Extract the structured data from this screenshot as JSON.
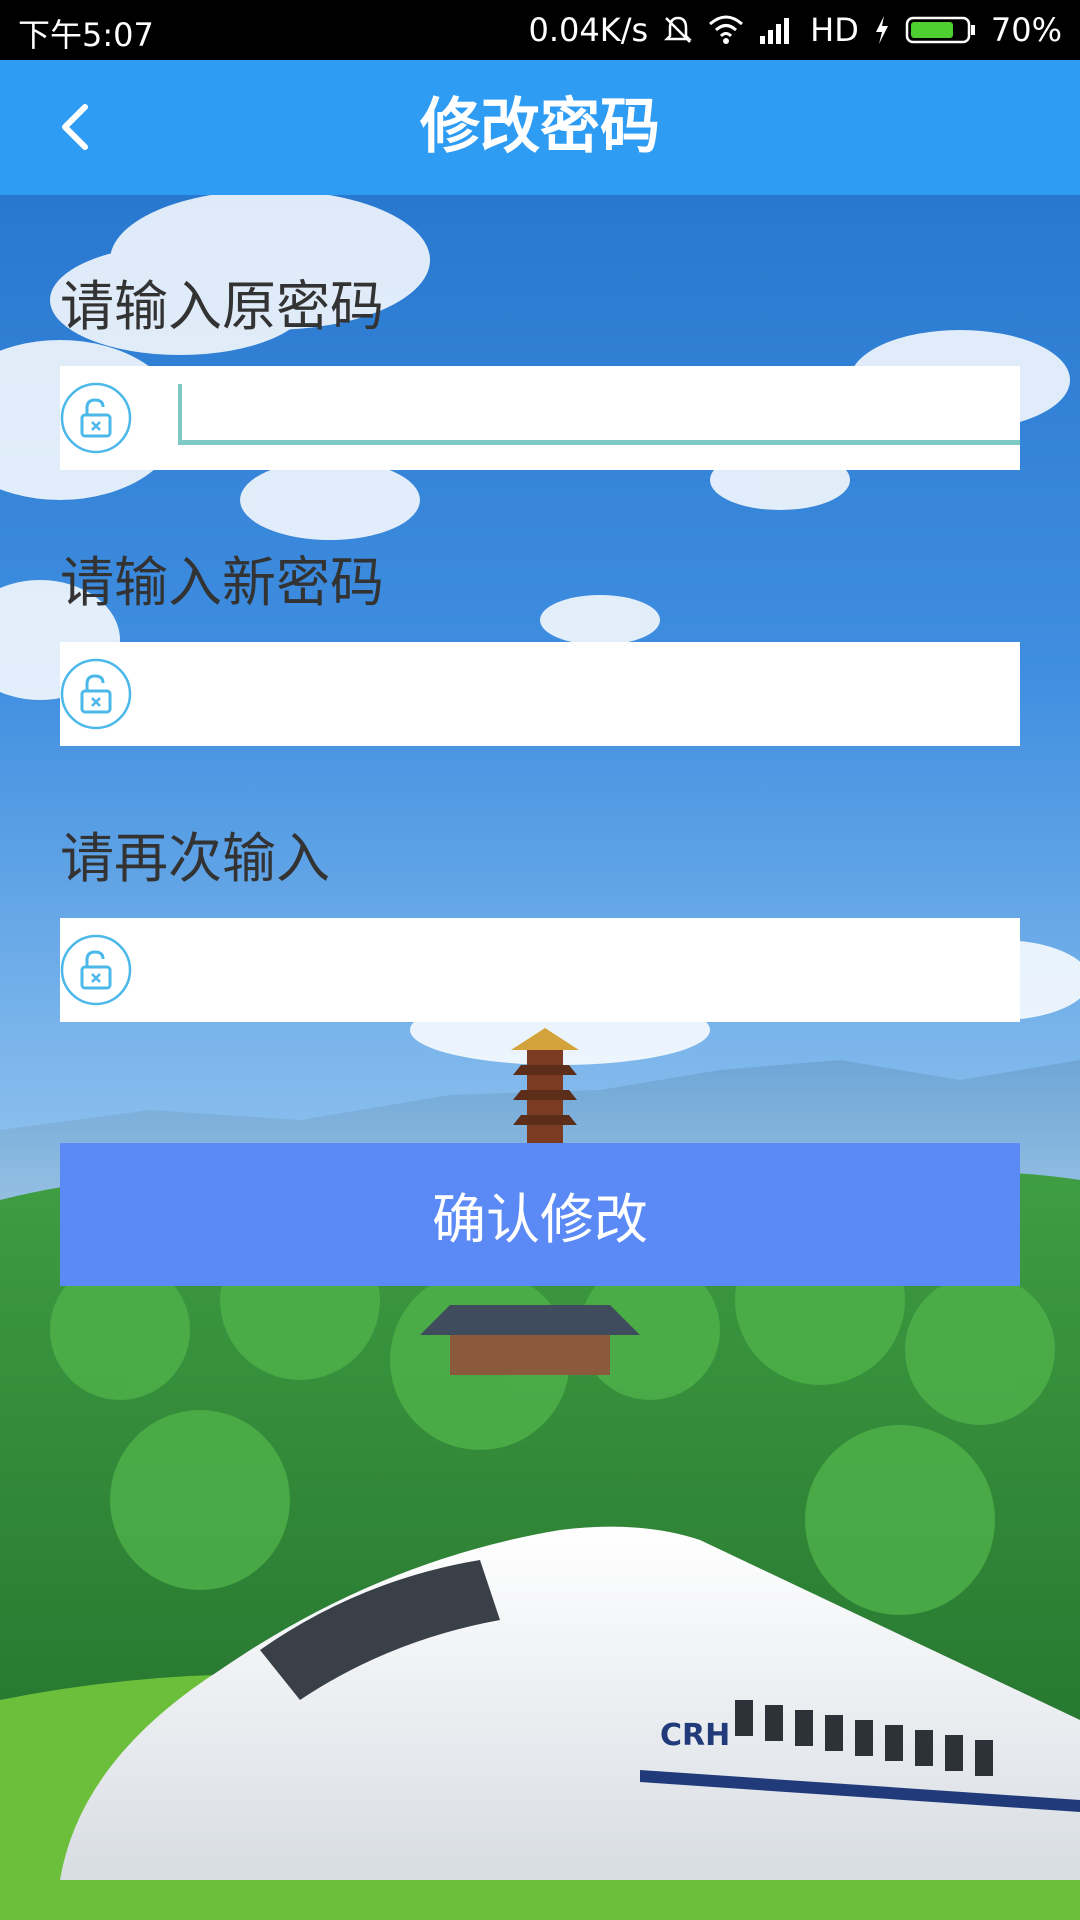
{
  "status_bar": {
    "time": "下午5:07",
    "network_speed": "0.04K/s",
    "network_type": "HD",
    "battery": "70%",
    "icons": [
      "bell-off-icon",
      "wifi-icon",
      "signal-icon",
      "charging-icon",
      "battery-icon"
    ]
  },
  "header": {
    "title": "修改密码",
    "back_icon": "chevron-left-icon"
  },
  "form": {
    "old_password": {
      "label": "请输入原密码",
      "value": "",
      "icon": "unlock-icon"
    },
    "new_password": {
      "label": "请输入新密码",
      "value": "",
      "icon": "unlock-icon"
    },
    "confirm_password": {
      "label": "请再次输入",
      "value": "",
      "icon": "unlock-icon"
    },
    "submit_label": "确认修改"
  },
  "background": {
    "scene": "train-mountain-scenery",
    "train_logo": "CRH"
  },
  "colors": {
    "status_bar": "#000000",
    "header": "#2f9cf4",
    "button": "#5b8af7",
    "icon": "#4bb8ea",
    "focus_underline": "#7fc9c4"
  }
}
